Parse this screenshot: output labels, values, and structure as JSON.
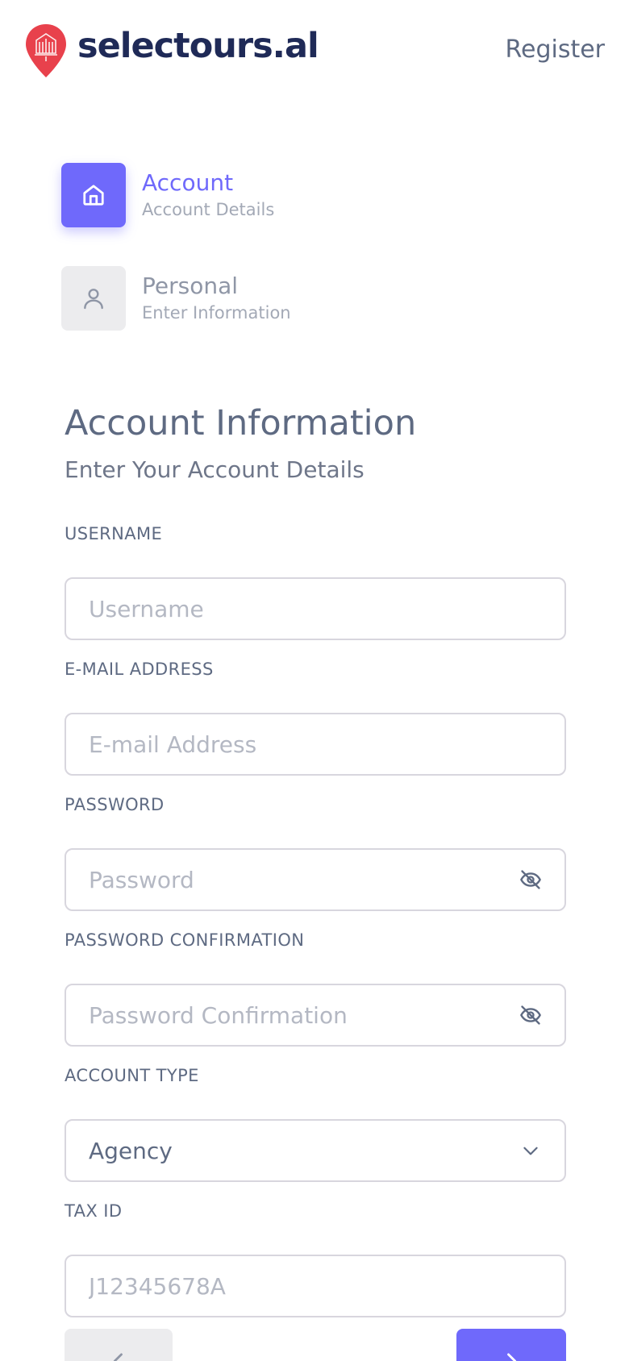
{
  "header": {
    "brand": "selectours.al",
    "register_label": "Register",
    "brand_color": "#1f2a57",
    "logo_color": "#e8414c"
  },
  "steps": [
    {
      "title": "Account",
      "subtitle": "Account Details",
      "icon": "home-icon",
      "active": true
    },
    {
      "title": "Personal",
      "subtitle": "Enter Information",
      "icon": "user-icon",
      "active": false
    }
  ],
  "section": {
    "title": "Account Information",
    "subtitle": "Enter Your Account Details"
  },
  "form": {
    "username": {
      "label": "USERNAME",
      "placeholder": "Username",
      "value": ""
    },
    "email": {
      "label": "E-MAIL ADDRESS",
      "placeholder": "E-mail Address",
      "value": ""
    },
    "password": {
      "label": "PASSWORD",
      "placeholder": "Password",
      "value": "",
      "icon": "eye-off-icon"
    },
    "password_confirmation": {
      "label": "PASSWORD CONFIRMATION",
      "placeholder": "Password Confirmation",
      "value": "",
      "icon": "eye-off-icon"
    },
    "account_type": {
      "label": "ACCOUNT TYPE",
      "selected": "Agency",
      "icon": "chevron-down-icon"
    },
    "tax_id": {
      "label": "TAX ID",
      "placeholder": "J12345678A",
      "value": ""
    }
  },
  "nav": {
    "prev_icon": "chevron-left-icon",
    "next_icon": "chevron-right-icon"
  },
  "colors": {
    "primary": "#6f69fb",
    "text": "#5e6a82",
    "muted": "#a3a9b6",
    "border": "#d8d6de",
    "inactive_bg": "#ececee"
  }
}
